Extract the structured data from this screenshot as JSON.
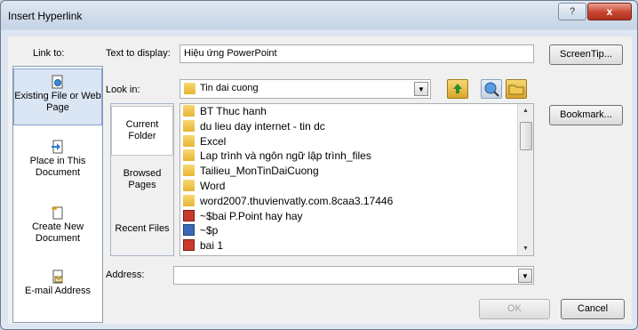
{
  "window": {
    "title": "Insert Hyperlink",
    "help": "?",
    "close": "x"
  },
  "link_to": {
    "label": "Link to:",
    "items": [
      {
        "label": "Existing File or Web Page",
        "icon": "file-globe-icon",
        "selected": true
      },
      {
        "label": "Place in This Document",
        "icon": "document-place-icon",
        "selected": false
      },
      {
        "label": "Create New Document",
        "icon": "new-document-icon",
        "selected": false
      },
      {
        "label": "E-mail Address",
        "icon": "email-icon",
        "selected": false
      }
    ]
  },
  "text_to_display": {
    "label": "Text to display:",
    "value": "Hiệu ứng PowerPoint"
  },
  "screentip": {
    "label": "ScreenTip..."
  },
  "look_in": {
    "label": "Look in:",
    "value": "Tin dai cuong"
  },
  "nav": {
    "items": [
      {
        "label": "Current Folder",
        "selected": true
      },
      {
        "label": "Browsed Pages",
        "selected": false
      },
      {
        "label": "Recent Files",
        "selected": false
      }
    ]
  },
  "files": [
    {
      "name": "BT Thuc hanh",
      "type": "folder"
    },
    {
      "name": "du lieu day internet - tin dc",
      "type": "folder"
    },
    {
      "name": "Excel",
      "type": "folder"
    },
    {
      "name": "Lap trình và ngôn ngữ lập trình_files",
      "type": "folder"
    },
    {
      "name": "Tailieu_MonTinDaiCuong",
      "type": "folder"
    },
    {
      "name": "Word",
      "type": "folder"
    },
    {
      "name": "word2007.thuvienvatly.com.8caa3.17446",
      "type": "folder"
    },
    {
      "name": "~$bai P.Point hay hay",
      "type": "ppt"
    },
    {
      "name": "~$p",
      "type": "doc"
    },
    {
      "name": "bai 1",
      "type": "ppt"
    }
  ],
  "bookmark": {
    "label": "Bookmark..."
  },
  "address": {
    "label": "Address:",
    "value": ""
  },
  "ok": {
    "label": "OK"
  },
  "cancel": {
    "label": "Cancel"
  },
  "colors": {
    "selected_bg": "#dbe6f4",
    "close_red": "#c8452f"
  }
}
